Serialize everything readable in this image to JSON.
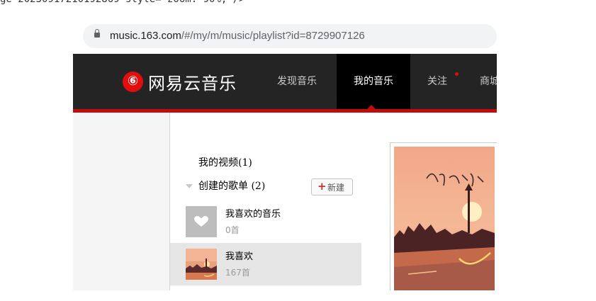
{
  "code_fragment": "ge 20230917210192869 style= zoom: 90%; />",
  "browser": {
    "url_host": "music.163.com",
    "url_path": "/#/my/m/music/playlist?id=8729907126"
  },
  "header": {
    "logo_glyph": "⑥",
    "brand": "网易云音乐",
    "nav": [
      {
        "label": "发现音乐",
        "active": false
      },
      {
        "label": "我的音乐",
        "active": true
      },
      {
        "label": "关注",
        "active": false,
        "has_dot": true
      },
      {
        "label": "商城",
        "active": false
      }
    ],
    "accent_color": "#c20c0c",
    "bar_color": "#242424"
  },
  "sidebar": {
    "my_videos": "我的视频(1)",
    "created_playlists": "创建的歌单 (2)",
    "new_button": {
      "icon": "plus-icon",
      "label": "新建"
    },
    "playlists": [
      {
        "name": "我喜欢的音乐",
        "count": "0首",
        "cover": "heart-icon",
        "selected": false
      },
      {
        "name": "我喜欢",
        "count": "167首",
        "cover": "sunset-artwork",
        "selected": true
      }
    ]
  },
  "main": {
    "cover_art": "sunset-artwork"
  }
}
